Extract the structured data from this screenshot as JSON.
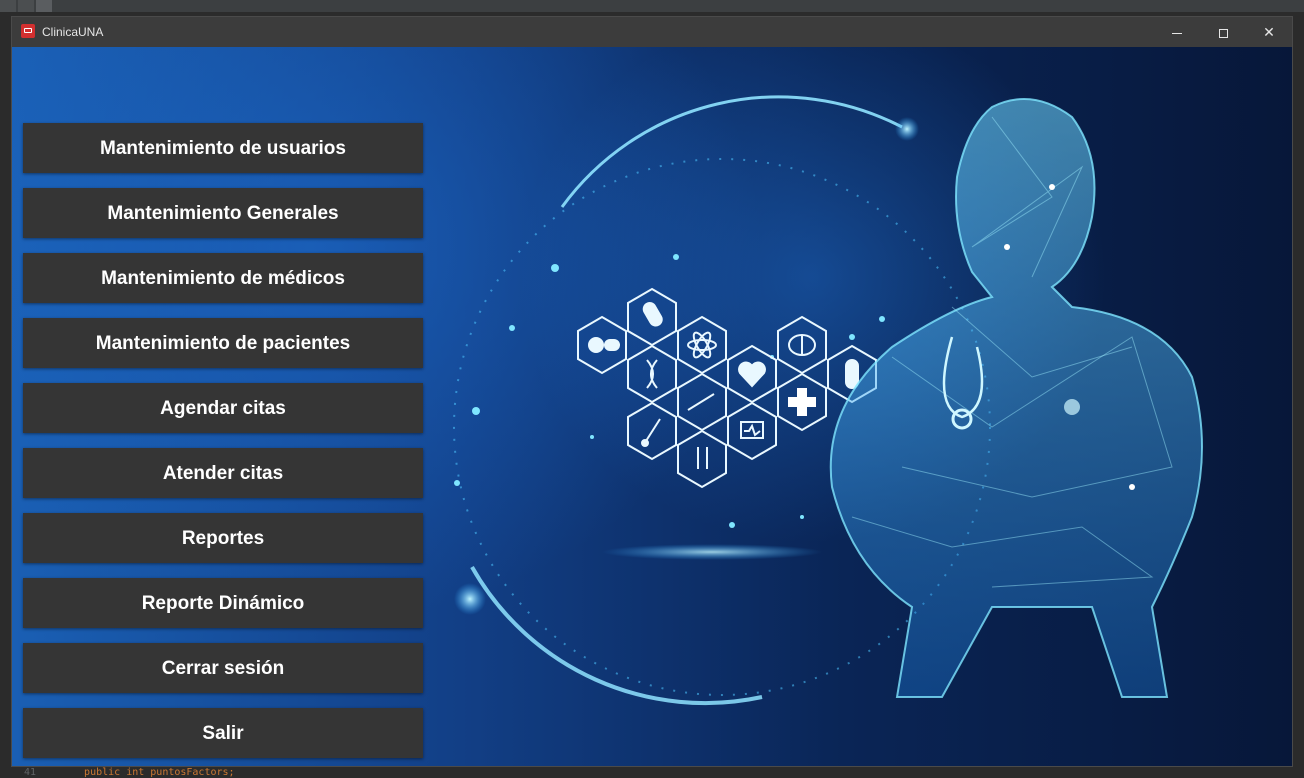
{
  "window": {
    "title": "ClinicaUNA"
  },
  "menu": {
    "buttons": [
      {
        "label": "Mantenimiento de usuarios"
      },
      {
        "label": "Mantenimiento Generales"
      },
      {
        "label": "Mantenimiento de médicos"
      },
      {
        "label": "Mantenimiento de pacientes"
      },
      {
        "label": "Agendar citas"
      },
      {
        "label": "Atender citas"
      },
      {
        "label": "Reportes"
      },
      {
        "label": "Reporte Dinámico"
      },
      {
        "label": "Cerrar sesión"
      },
      {
        "label": "Salir"
      }
    ]
  },
  "background": {
    "bottom_line_number": "41",
    "bottom_code": "public int puntosFactors;"
  },
  "colors": {
    "button_bg": "#353535",
    "titlebar_bg": "#3c3c3c",
    "accent_glow": "#5fd3ff"
  },
  "icons": [
    "app-icon",
    "minimize-icon",
    "maximize-icon",
    "close-icon",
    "pill-icon",
    "dna-icon",
    "heart-icon",
    "cross-icon",
    "brain-icon",
    "atom-icon",
    "thermometer-icon",
    "test-tube-icon",
    "monitor-icon",
    "syringe-icon",
    "capsule-icon"
  ]
}
